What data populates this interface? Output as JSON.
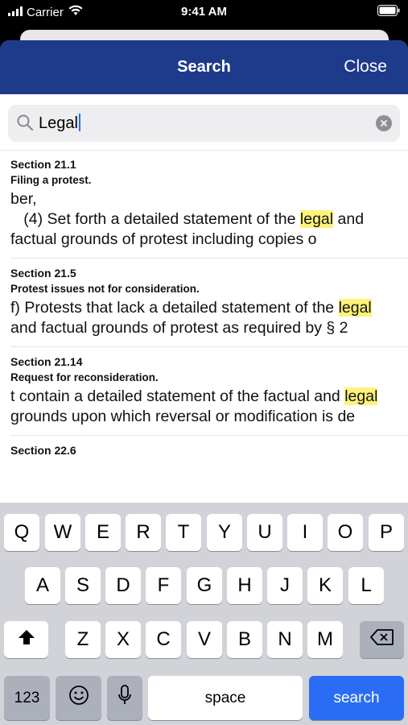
{
  "status_bar": {
    "carrier": "Carrier",
    "time": "9:41 AM"
  },
  "navbar": {
    "title": "Search",
    "close_label": "Close",
    "color": "#1e3a8a"
  },
  "search": {
    "value": "Legal"
  },
  "results": [
    {
      "section": "Section 21.1",
      "subtitle": "Filing a protest.",
      "snippet_before": "ber,\n   (4) Set forth a detailed statement of the ",
      "highlight": "legal",
      "snippet_after": " and factual grounds of protest including copies o"
    },
    {
      "section": "Section 21.5",
      "subtitle": "Protest issues not for consideration.",
      "snippet_before": "f) Protests that lack a detailed statement of the ",
      "highlight": "legal",
      "snippet_after": " and factual grounds of protest as required by § 2"
    },
    {
      "section": "Section 21.14",
      "subtitle": "Request for reconsideration.",
      "snippet_before": "t contain a detailed statement of the factual and ",
      "highlight": "legal",
      "snippet_after": " grounds upon which reversal or modification is de"
    },
    {
      "section": "Section 22.6",
      "subtitle": "",
      "snippet_before": "",
      "highlight": "",
      "snippet_after": ""
    }
  ],
  "keyboard": {
    "row1": [
      "Q",
      "W",
      "E",
      "R",
      "T",
      "Y",
      "U",
      "I",
      "O",
      "P"
    ],
    "row2": [
      "A",
      "S",
      "D",
      "F",
      "G",
      "H",
      "J",
      "K",
      "L"
    ],
    "row3": [
      "Z",
      "X",
      "C",
      "V",
      "B",
      "N",
      "M"
    ],
    "numbers_label": "123",
    "space_label": "space",
    "search_label": "search"
  }
}
